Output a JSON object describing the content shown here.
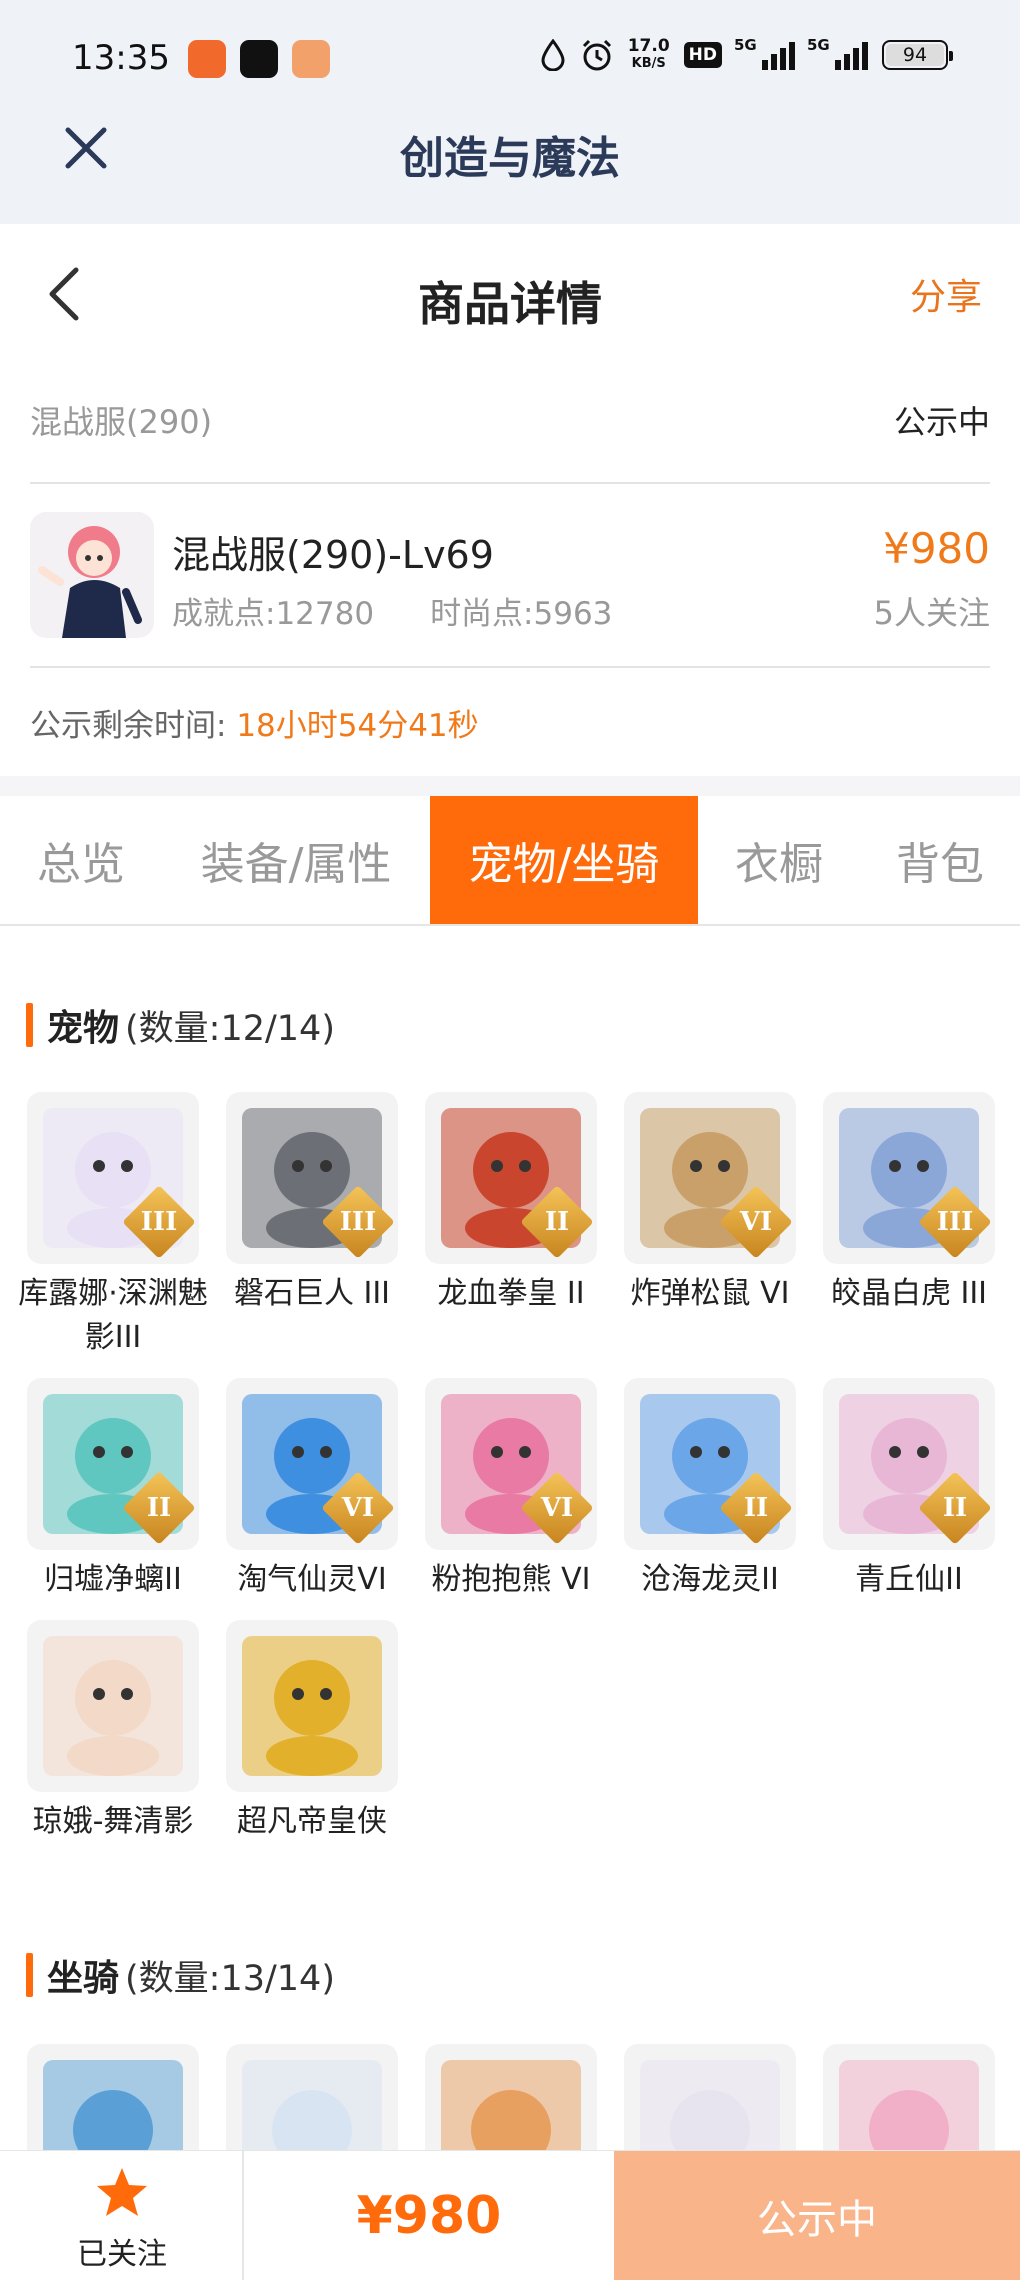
{
  "status_bar": {
    "time": "13:35",
    "net_speed_value": "17.0",
    "net_speed_unit": "KB/S",
    "hd_label": "HD",
    "signal1_label": "5G",
    "signal2_label": "5G",
    "battery": "94",
    "icons": [
      "alarm-icon",
      "water-drop-icon"
    ]
  },
  "app_bar": {
    "title": "创造与魔法"
  },
  "page_header": {
    "title": "商品详情",
    "share": "分享"
  },
  "listing": {
    "server": "混战服(290)",
    "status": "公示中",
    "char_name": "混战服(290)-Lv69",
    "achievement": "成就点:12780",
    "fashion": "时尚点:5963",
    "price": "¥980",
    "followers": "5人关注",
    "remain_label": "公示剩余时间:",
    "remain_value": "18小时54分41秒"
  },
  "tabs": [
    {
      "label": "总览",
      "active": false
    },
    {
      "label": "装备/属性",
      "active": false
    },
    {
      "label": "宠物/坐骑",
      "active": true
    },
    {
      "label": "衣橱",
      "active": false
    },
    {
      "label": "背包",
      "active": false
    }
  ],
  "pets_section": {
    "title": "宠物",
    "count": "(数量:12/14)"
  },
  "pets": [
    {
      "name": "库露娜·深渊魅影III",
      "tier": "III",
      "color": "#e8e0f5"
    },
    {
      "name": "磐石巨人 III",
      "tier": "III",
      "color": "#6c6f76"
    },
    {
      "name": "龙血拳皇 II",
      "tier": "II",
      "color": "#c9452e"
    },
    {
      "name": "炸弹松鼠 VI",
      "tier": "VI",
      "color": "#c9a06a"
    },
    {
      "name": "皎晶白虎 III",
      "tier": "III",
      "color": "#8aa7d8"
    },
    {
      "name": "归墟净螭II",
      "tier": "II",
      "color": "#5fc7c0"
    },
    {
      "name": "淘气仙灵VI",
      "tier": "VI",
      "color": "#3f8fe0"
    },
    {
      "name": "粉抱抱熊 VI",
      "tier": "VI",
      "color": "#e87aa4"
    },
    {
      "name": "沧海龙灵II",
      "tier": "II",
      "color": "#6aa6e8"
    },
    {
      "name": "青丘仙II",
      "tier": "II",
      "color": "#e9b7d6"
    },
    {
      "name": "琼娥-舞清影",
      "tier": "",
      "color": "#f2d9c8"
    },
    {
      "name": "超凡帝皇侠",
      "tier": "",
      "color": "#e3b02c"
    }
  ],
  "mounts_section": {
    "title": "坐骑",
    "count": "(数量:13/14)"
  },
  "mounts": [
    {
      "color": "#5a9fd6"
    },
    {
      "color": "#d9e4f2"
    },
    {
      "color": "#e8a060"
    },
    {
      "color": "#e7e4f0"
    },
    {
      "color": "#f2b0c8"
    }
  ],
  "bottom_bar": {
    "follow_label": "已关注",
    "price": "¥980",
    "status_button": "公示中"
  },
  "colors": {
    "accent": "#ff6a0a",
    "price": "#f07a1a",
    "button_disabled": "#f9b48a"
  }
}
